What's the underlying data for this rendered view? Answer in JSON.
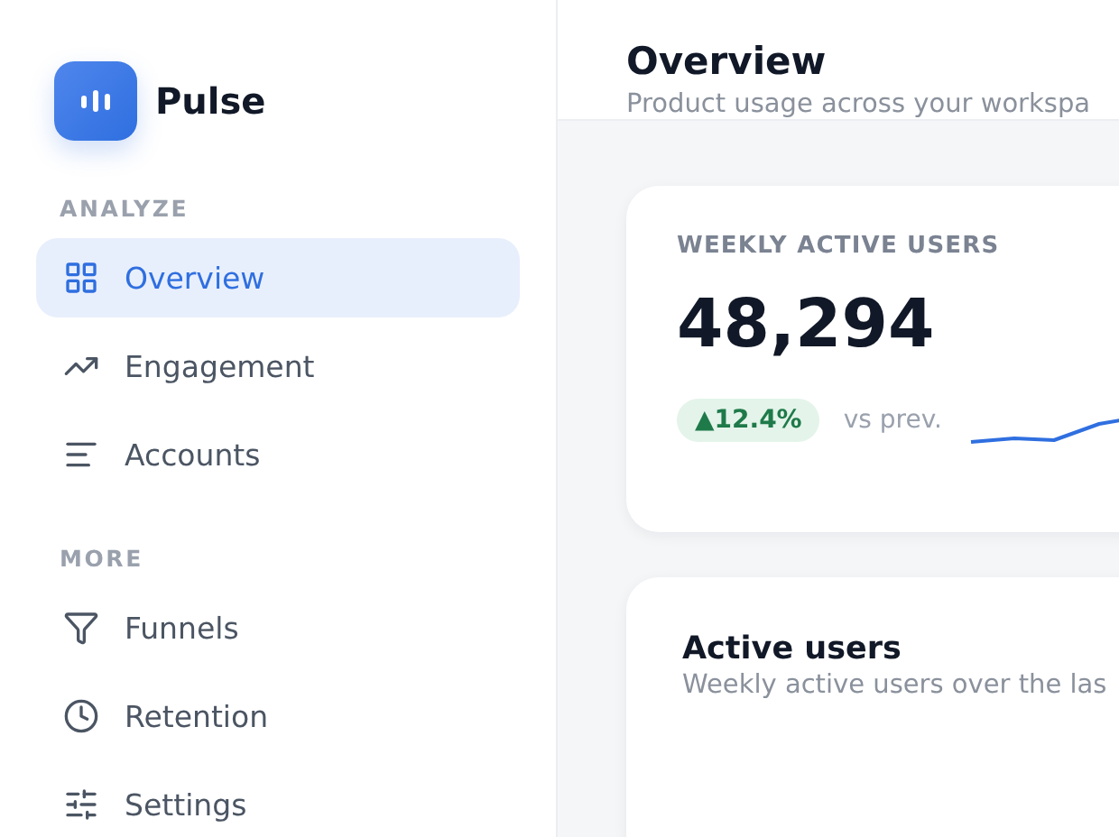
{
  "app": {
    "name": "Pulse"
  },
  "sidebar": {
    "sections": [
      {
        "label": "ANALYZE",
        "items": [
          {
            "label": "Overview",
            "selected": true
          },
          {
            "label": "Engagement",
            "selected": false
          },
          {
            "label": "Accounts",
            "selected": false
          }
        ]
      },
      {
        "label": "MORE",
        "items": [
          {
            "label": "Funnels",
            "selected": false
          },
          {
            "label": "Retention",
            "selected": false
          },
          {
            "label": "Settings",
            "selected": false
          }
        ]
      }
    ]
  },
  "header": {
    "title": "Overview",
    "subtitle": "Product usage across your workspa"
  },
  "metric_card": {
    "label": "WEEKLY ACTIVE USERS",
    "value": "48,294",
    "change": "▲12.4%",
    "comparison": "vs prev."
  },
  "chart_card": {
    "title": "Active users",
    "subtitle": "Weekly active users over the las"
  }
}
